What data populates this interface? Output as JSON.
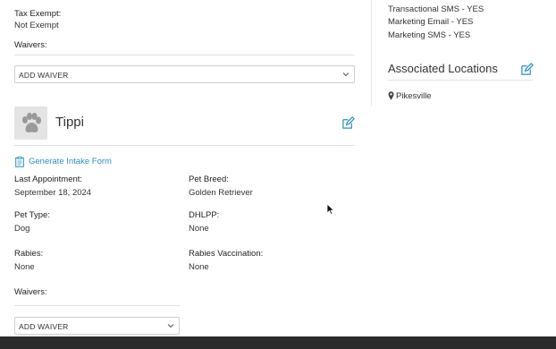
{
  "customer": {
    "tax_exempt_label": "Tax Exempt:",
    "tax_exempt_value": "Not Exempt",
    "waivers_label": "Waivers:",
    "add_waiver_label": "ADD WAIVER"
  },
  "preferences": {
    "items": [
      "Transactional SMS - YES",
      "Marketing Email - YES",
      "Marketing SMS - YES"
    ]
  },
  "locations": {
    "title": "Associated Locations",
    "items": [
      "Pikesville"
    ]
  },
  "pet": {
    "name": "Tippi",
    "intake_link": "Generate Intake Form",
    "last_appointment_label": "Last Appointment:",
    "last_appointment_value": "September 18, 2024",
    "breed_label": "Pet Breed:",
    "breed_value": "Golden Retriever",
    "type_label": "Pet Type:",
    "type_value": "Dog",
    "dhlpp_label": "DHLPP:",
    "dhlpp_value": "None",
    "rabies_label": "Rabies:",
    "rabies_value": "None",
    "rabies_vaccination_label": "Rabies Vaccination:",
    "rabies_vaccination_value": "None",
    "waivers_label": "Waivers:",
    "add_waiver_label": "ADD WAIVER"
  },
  "colors": {
    "accent": "#2a8fbd",
    "bottom_bar": "#2b2b2b"
  }
}
